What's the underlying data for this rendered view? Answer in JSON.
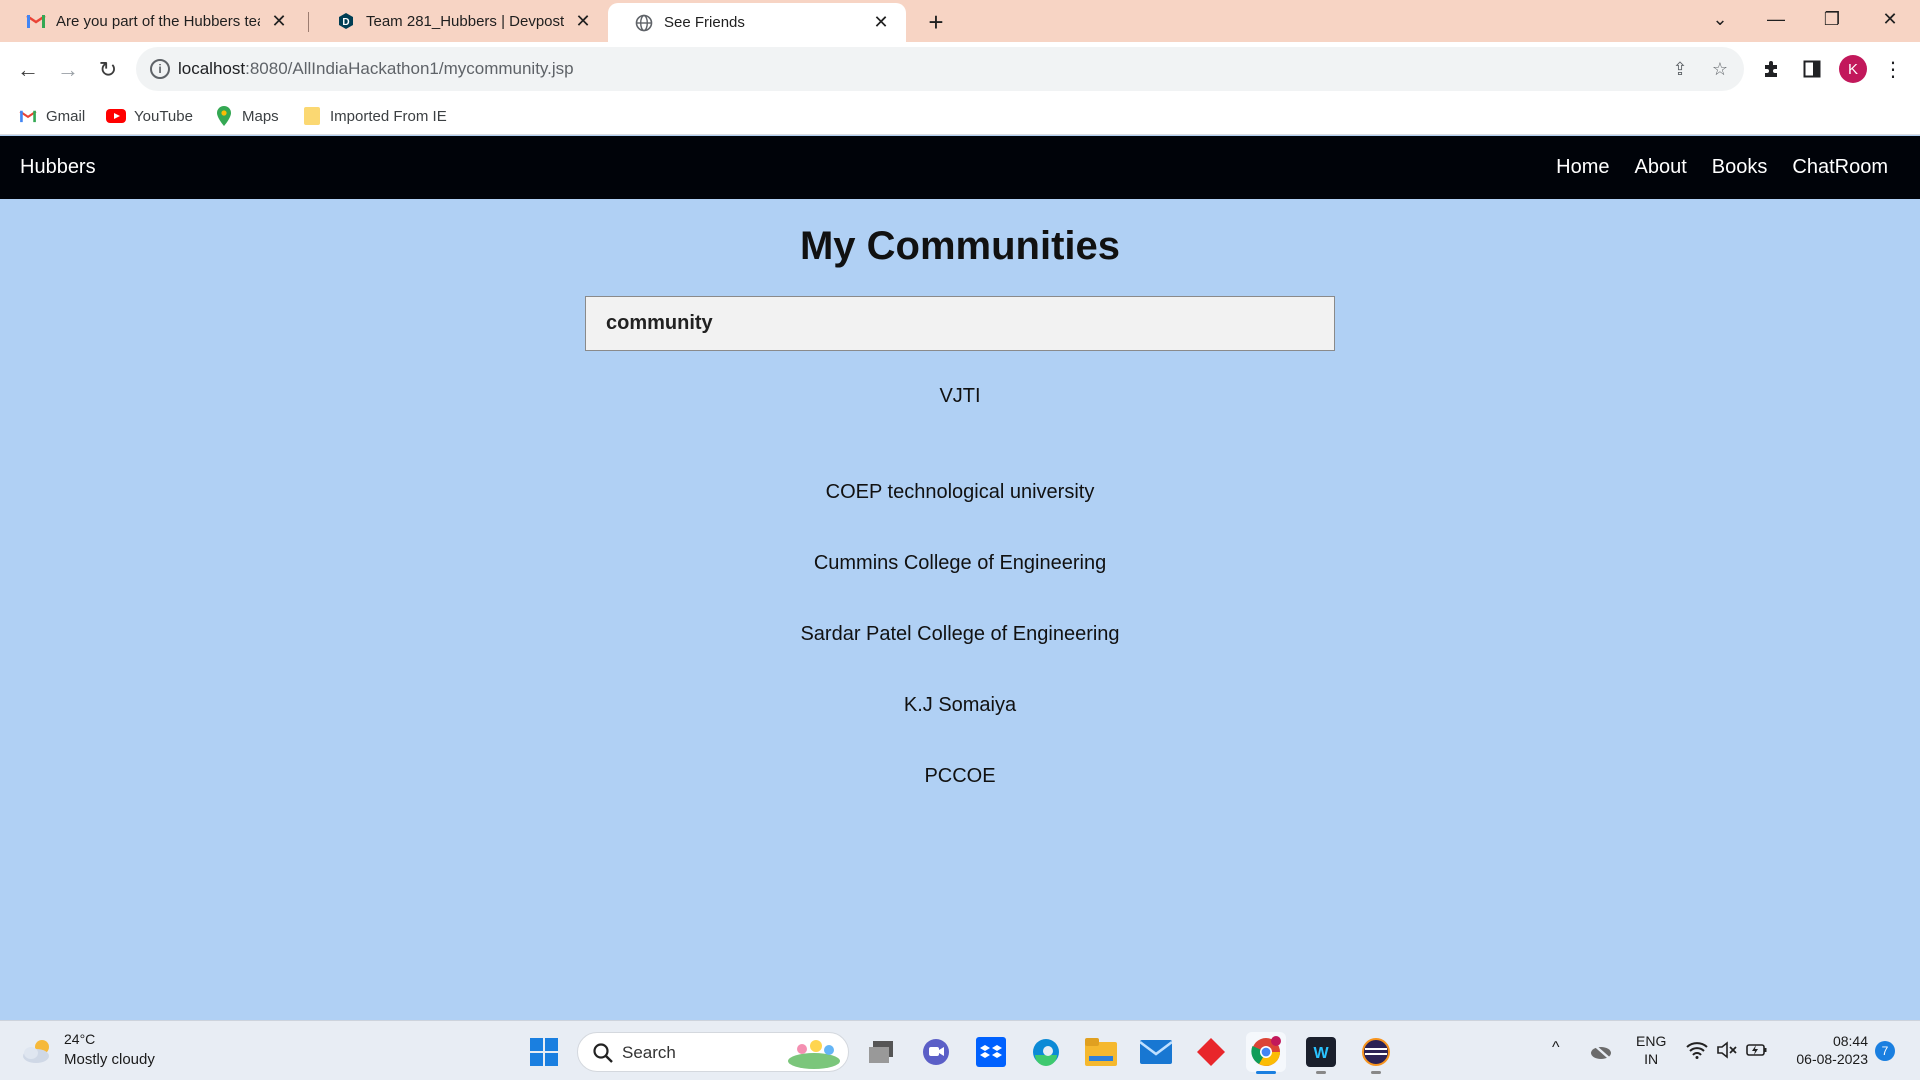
{
  "browser": {
    "tabs": [
      {
        "title": "Are you part of the Hubbers team",
        "icon": "gmail-icon"
      },
      {
        "title": "Team 281_Hubbers | Devpost",
        "icon": "devpost-icon"
      },
      {
        "title": "See Friends",
        "icon": "globe-icon"
      }
    ],
    "url_host": "localhost",
    "url_path": ":8080/AllIndiaHackathon1/mycommunity.jsp",
    "profile_initial": "K",
    "bookmarks": [
      {
        "label": "Gmail"
      },
      {
        "label": "YouTube"
      },
      {
        "label": "Maps"
      },
      {
        "label": "Imported From IE"
      }
    ]
  },
  "site": {
    "brand": "Hubbers",
    "nav": [
      "Home",
      "About",
      "Books",
      "ChatRoom"
    ],
    "page_title": "My Communities",
    "search_value": "community",
    "communities": [
      "VJTI",
      "COEP technological university",
      "Cummins College of Engineering",
      "Sardar Patel College of Engineering",
      "K.J Somaiya",
      "PCCOE"
    ]
  },
  "taskbar": {
    "weather_temp": "24°C",
    "weather_desc": "Mostly cloudy",
    "search_label": "Search",
    "lang_top": "ENG",
    "lang_bottom": "IN",
    "time": "08:44",
    "date": "06-08-2023",
    "notification_count": "7"
  },
  "colors": {
    "page_bg": "#b0d0f4",
    "navbar_bg": "#000309",
    "tabstrip_bg": "#f7d4c4"
  }
}
